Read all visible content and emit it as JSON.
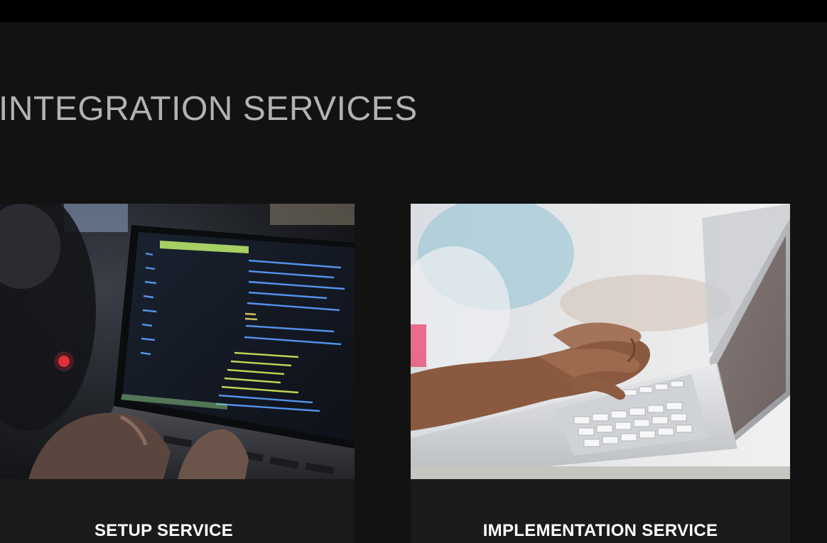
{
  "section": {
    "title": "INTEGRATION SERVICES"
  },
  "cards": [
    {
      "title": "SETUP SERVICE",
      "image": "laptop-code-screen-photo"
    },
    {
      "title": "IMPLEMENTATION SERVICE",
      "image": "hands-typing-laptop-photo"
    }
  ],
  "colors": {
    "page_background": "#121212",
    "top_bar": "#000000",
    "heading_text": "#b2b2b2",
    "card_background": "#1b1b1b",
    "card_title_text": "#ffffff"
  }
}
